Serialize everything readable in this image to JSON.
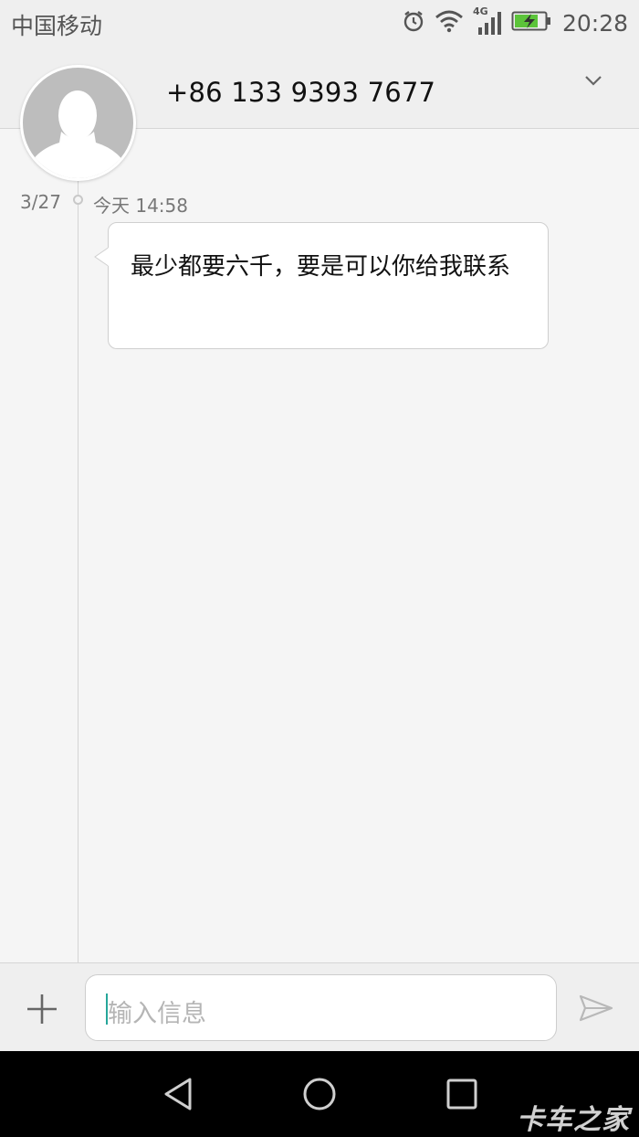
{
  "status_bar": {
    "carrier": "中国移动",
    "network_type": "4G",
    "time": "20:28",
    "icons": [
      "alarm-icon",
      "wifi-icon",
      "cell-signal-icon",
      "battery-charging-icon"
    ]
  },
  "header": {
    "contact_number": "+86 133 9393 7677",
    "expand_icon": "chevron-down-icon"
  },
  "conversation": {
    "date": "3/27",
    "time": "今天 14:58",
    "messages": [
      {
        "direction": "incoming",
        "text": "最少都要六千，要是可以你给我联系"
      }
    ]
  },
  "composer": {
    "placeholder": "输入信息",
    "add_icon": "plus-icon",
    "send_icon": "send-icon"
  },
  "nav_bar": {
    "buttons": [
      "back-icon",
      "home-icon",
      "recents-icon"
    ],
    "watermark": "卡车之家"
  },
  "colors": {
    "background": "#f5f5f5",
    "bars": "#efefef",
    "cursor_accent": "#26a69a",
    "nav": "#000000"
  }
}
